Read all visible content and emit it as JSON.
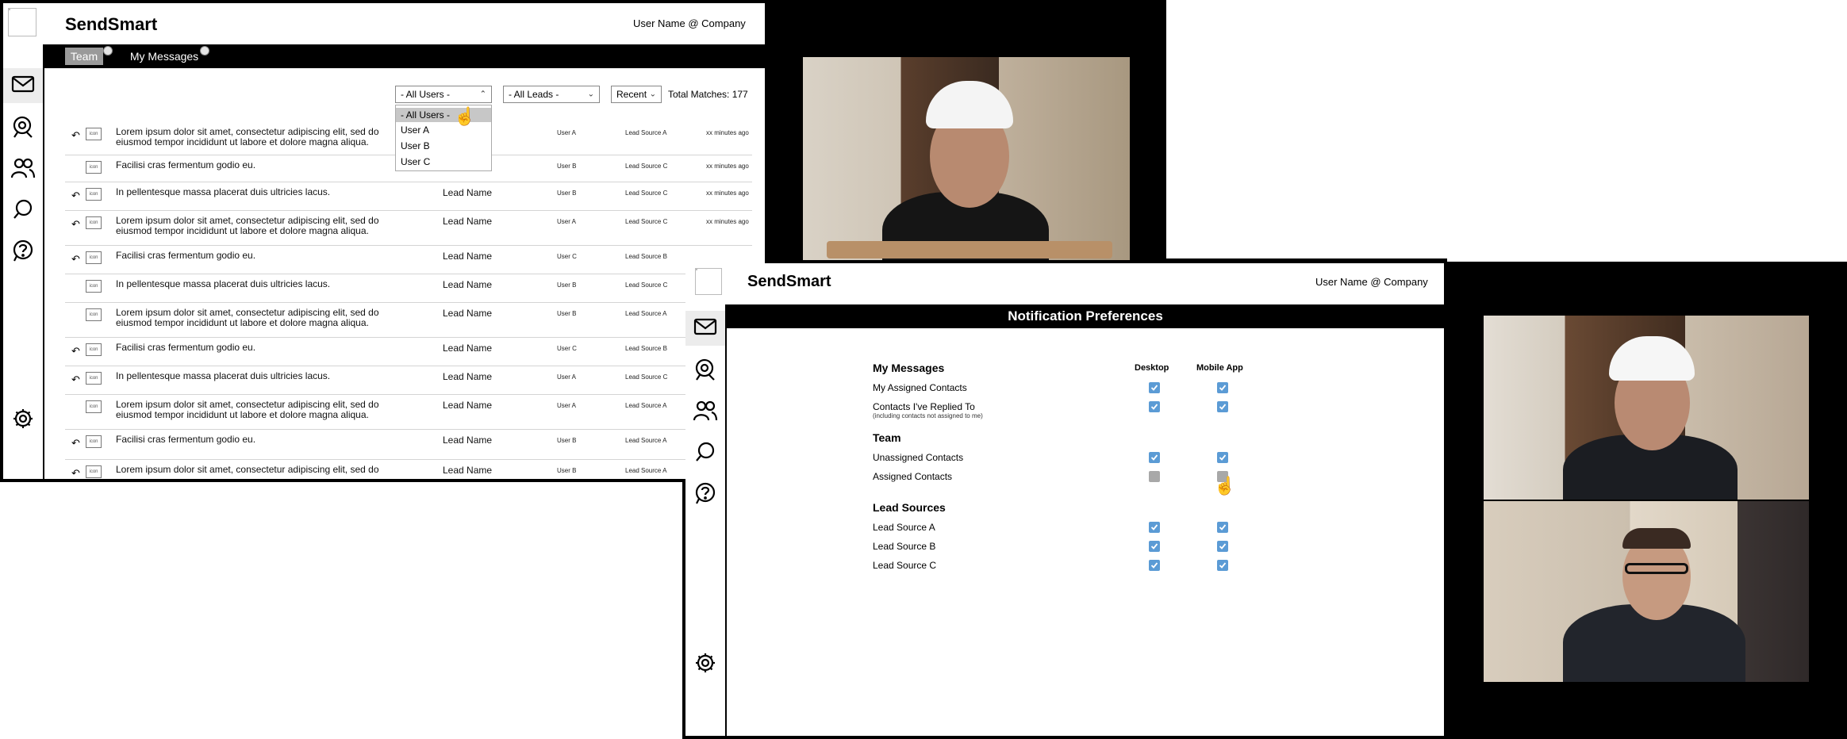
{
  "app": {
    "brand": "SendSmart",
    "user": "User Name @ Company",
    "logo_icon": "grid-logo-icon"
  },
  "sidebar": {
    "items": [
      {
        "name": "mail",
        "icon": "envelope-icon",
        "active": true
      },
      {
        "name": "leads",
        "icon": "location-pin-icon",
        "active": false
      },
      {
        "name": "team",
        "icon": "users-icon",
        "active": false
      },
      {
        "name": "search",
        "icon": "search-icon",
        "active": false
      },
      {
        "name": "help",
        "icon": "help-icon",
        "active": false
      },
      {
        "name": "settings",
        "icon": "gear-icon",
        "active": false
      }
    ]
  },
  "messages_view": {
    "tabs": [
      {
        "label": "Team",
        "active": true
      },
      {
        "label": "My Messages",
        "active": false
      }
    ],
    "filters": {
      "users": "- All Users -",
      "leads": "- All Leads -",
      "sort": "Recent",
      "total": "Total Matches: 177"
    },
    "users_dropdown": {
      "options": [
        "- All Users -",
        "User A",
        "User B",
        "User C"
      ],
      "selected": "- All Users -"
    },
    "rows": [
      {
        "reply": true,
        "icon_text": "icon",
        "message": "Lorem ipsum dolor sit amet, consectetur adipiscing elit, sed do eiusmod tempor incididunt ut labore et dolore magna aliqua.",
        "lead": "",
        "user": "User A",
        "source": "Lead Source A",
        "time": "xx minutes ago"
      },
      {
        "reply": false,
        "icon_text": "icon",
        "message": "Facilisi cras fermentum godio eu.",
        "lead": "Lead Name",
        "user": "User B",
        "source": "Lead Source C",
        "time": "xx minutes ago"
      },
      {
        "reply": true,
        "icon_text": "icon",
        "message": "In pellentesque massa placerat duis ultricies lacus.",
        "lead": "Lead Name",
        "user": "User B",
        "source": "Lead Source C",
        "time": "xx minutes ago"
      },
      {
        "reply": true,
        "icon_text": "icon",
        "message": "Lorem ipsum dolor sit amet, consectetur adipiscing elit, sed do eiusmod tempor incididunt ut labore et dolore magna aliqua.",
        "lead": "Lead Name",
        "user": "User A",
        "source": "Lead Source C",
        "time": "xx minutes ago"
      },
      {
        "reply": true,
        "icon_text": "icon",
        "message": "Facilisi cras fermentum godio eu.",
        "lead": "Lead Name",
        "user": "User C",
        "source": "Lead Source B",
        "time": ""
      },
      {
        "reply": false,
        "icon_text": "icon",
        "message": "In pellentesque massa placerat duis ultricies lacus.",
        "lead": "Lead Name",
        "user": "User B",
        "source": "Lead Source C",
        "time": ""
      },
      {
        "reply": false,
        "icon_text": "icon",
        "message": "Lorem ipsum dolor sit amet, consectetur adipiscing elit, sed do eiusmod tempor incididunt ut labore et dolore magna aliqua.",
        "lead": "Lead Name",
        "user": "User B",
        "source": "Lead Source A",
        "time": ""
      },
      {
        "reply": true,
        "icon_text": "icon",
        "message": "Facilisi cras fermentum godio eu.",
        "lead": "Lead Name",
        "user": "User C",
        "source": "Lead Source B",
        "time": ""
      },
      {
        "reply": true,
        "icon_text": "icon",
        "message": "In pellentesque massa placerat duis ultricies lacus.",
        "lead": "Lead Name",
        "user": "User A",
        "source": "Lead Source C",
        "time": ""
      },
      {
        "reply": false,
        "icon_text": "icon",
        "message": "Lorem ipsum dolor sit amet, consectetur adipiscing elit, sed do eiusmod tempor incididunt ut labore et dolore magna aliqua.",
        "lead": "Lead Name",
        "user": "User A",
        "source": "Lead Source A",
        "time": ""
      },
      {
        "reply": true,
        "icon_text": "icon",
        "message": "Facilisi cras fermentum godio eu.",
        "lead": "Lead Name",
        "user": "User B",
        "source": "Lead Source A",
        "time": ""
      },
      {
        "reply": true,
        "icon_text": "icon",
        "message": "Lorem ipsum dolor sit amet, consectetur adipiscing elit, sed do",
        "lead": "Lead Name",
        "user": "User B",
        "source": "Lead Source A",
        "time": ""
      }
    ]
  },
  "prefs_view": {
    "title": "Notification Preferences",
    "col_desktop": "Desktop",
    "col_mobile": "Mobile App",
    "sections": [
      {
        "title": "My Messages",
        "items": [
          {
            "label": "My Assigned Contacts",
            "sub": "",
            "desktop": true,
            "mobile": true
          },
          {
            "label": "Contacts I've Replied To",
            "sub": "(including contacts not assigned to me)",
            "desktop": true,
            "mobile": true
          }
        ]
      },
      {
        "title": "Team",
        "items": [
          {
            "label": "Unassigned Contacts",
            "sub": "",
            "desktop": true,
            "mobile": true
          },
          {
            "label": "Assigned Contacts",
            "sub": "",
            "desktop": false,
            "mobile": false
          }
        ]
      },
      {
        "title": "Lead Sources",
        "items": [
          {
            "label": "Lead Source A",
            "sub": "",
            "desktop": true,
            "mobile": true
          },
          {
            "label": "Lead Source B",
            "sub": "",
            "desktop": true,
            "mobile": true
          },
          {
            "label": "Lead Source C",
            "sub": "",
            "desktop": true,
            "mobile": true
          }
        ]
      }
    ]
  },
  "colors": {
    "accent_checkbox": "#5b9bd5",
    "tab_active": "#9a9a9a",
    "bar": "#000000"
  }
}
